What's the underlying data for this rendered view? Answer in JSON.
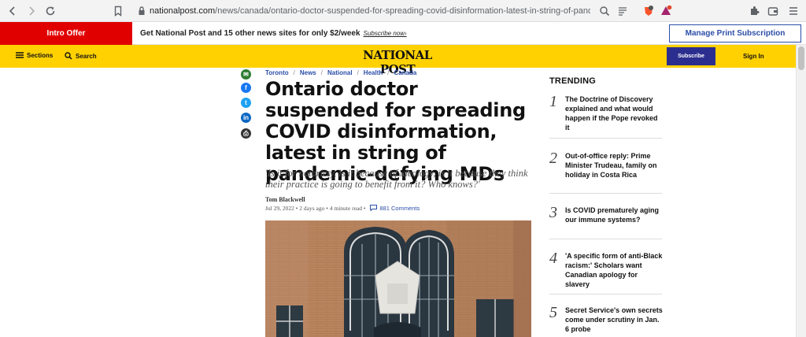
{
  "browser": {
    "url_host": "nationalpost.com",
    "url_path": "/news/canada/ontario-doctor-suspended-for-spreading-covid-disinformation-latest-in-string-of-pand..."
  },
  "promo": {
    "intro_offer": "Intro Offer",
    "text": "Get National Post and 15 other news sites for only $2/week",
    "link": "Subscribe now›",
    "manage_btn": "Manage Print Subscription"
  },
  "header": {
    "sections": "Sections",
    "search": "Search",
    "logo": "NATIONAL POST",
    "subscribe": "Subscribe",
    "signin": "Sign In"
  },
  "article": {
    "breadcrumb": [
      "Toronto",
      "News",
      "National",
      "Health",
      "Canada"
    ],
    "headline": "Ontario doctor suspended for spreading COVID disinformation, latest in string of pandemic-defying MDs",
    "deck": "'Is it for notoriety, is it because of ideology, is it because they think their practice is going to benefit from it? Who knows?'",
    "author": "Tom Blackwell",
    "date": "Jul 29, 2022",
    "ago": "2 days ago",
    "read_time": "4 minute read",
    "comments": "881 Comments"
  },
  "trending": {
    "title": "TRENDING",
    "items": [
      {
        "num": "1",
        "text": "The Doctrine of Discovery explained and what would happen if the Pope revoked it"
      },
      {
        "num": "2",
        "text": "Out-of-office reply: Prime Minister Trudeau, family on holiday in Costa Rica"
      },
      {
        "num": "3",
        "text": "Is COVID prematurely aging our immune systems?"
      },
      {
        "num": "4",
        "text": "'A specific form of anti-Black racism:' Scholars want Canadian apology for slavery"
      },
      {
        "num": "5",
        "text": "Secret Service's own secrets come under scrutiny in Jan. 6 probe"
      }
    ]
  },
  "colors": {
    "brand_yellow": "#ffd100",
    "promo_red": "#e10000",
    "link_blue": "#2c4ea8",
    "subscribe_bg": "#2c2e8f"
  },
  "icons": [
    "back-icon",
    "forward-icon",
    "reload-icon",
    "bookmark-icon",
    "lock-icon",
    "zoom-icon",
    "reader-icon",
    "brave-icon",
    "rewards-icon",
    "extensions-icon",
    "wallet-icon",
    "menu-icon",
    "hamburger-icon",
    "search-icon",
    "email-icon",
    "facebook-icon",
    "twitter-icon",
    "linkedin-icon",
    "print-icon",
    "comment-icon"
  ]
}
